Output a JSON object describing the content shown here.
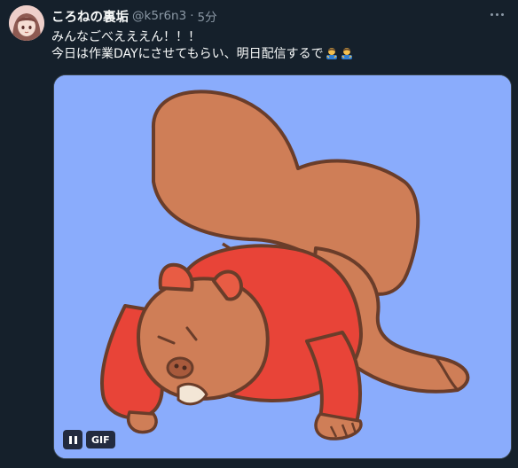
{
  "tweet": {
    "display_name": "ころねの裏垢",
    "handle": "@k5r6n3",
    "separator": "·",
    "time": "5分",
    "lines": [
      "みんなごべえええん！！！",
      "今日は作業DAYにさせてもらい、明日配信するで"
    ]
  },
  "media": {
    "gif_label": "GIF",
    "background_color": "#8aacfc"
  },
  "icons": {
    "more": "more-options-icon",
    "pause": "pause-icon",
    "emoji": "bowing-person-emoji"
  }
}
